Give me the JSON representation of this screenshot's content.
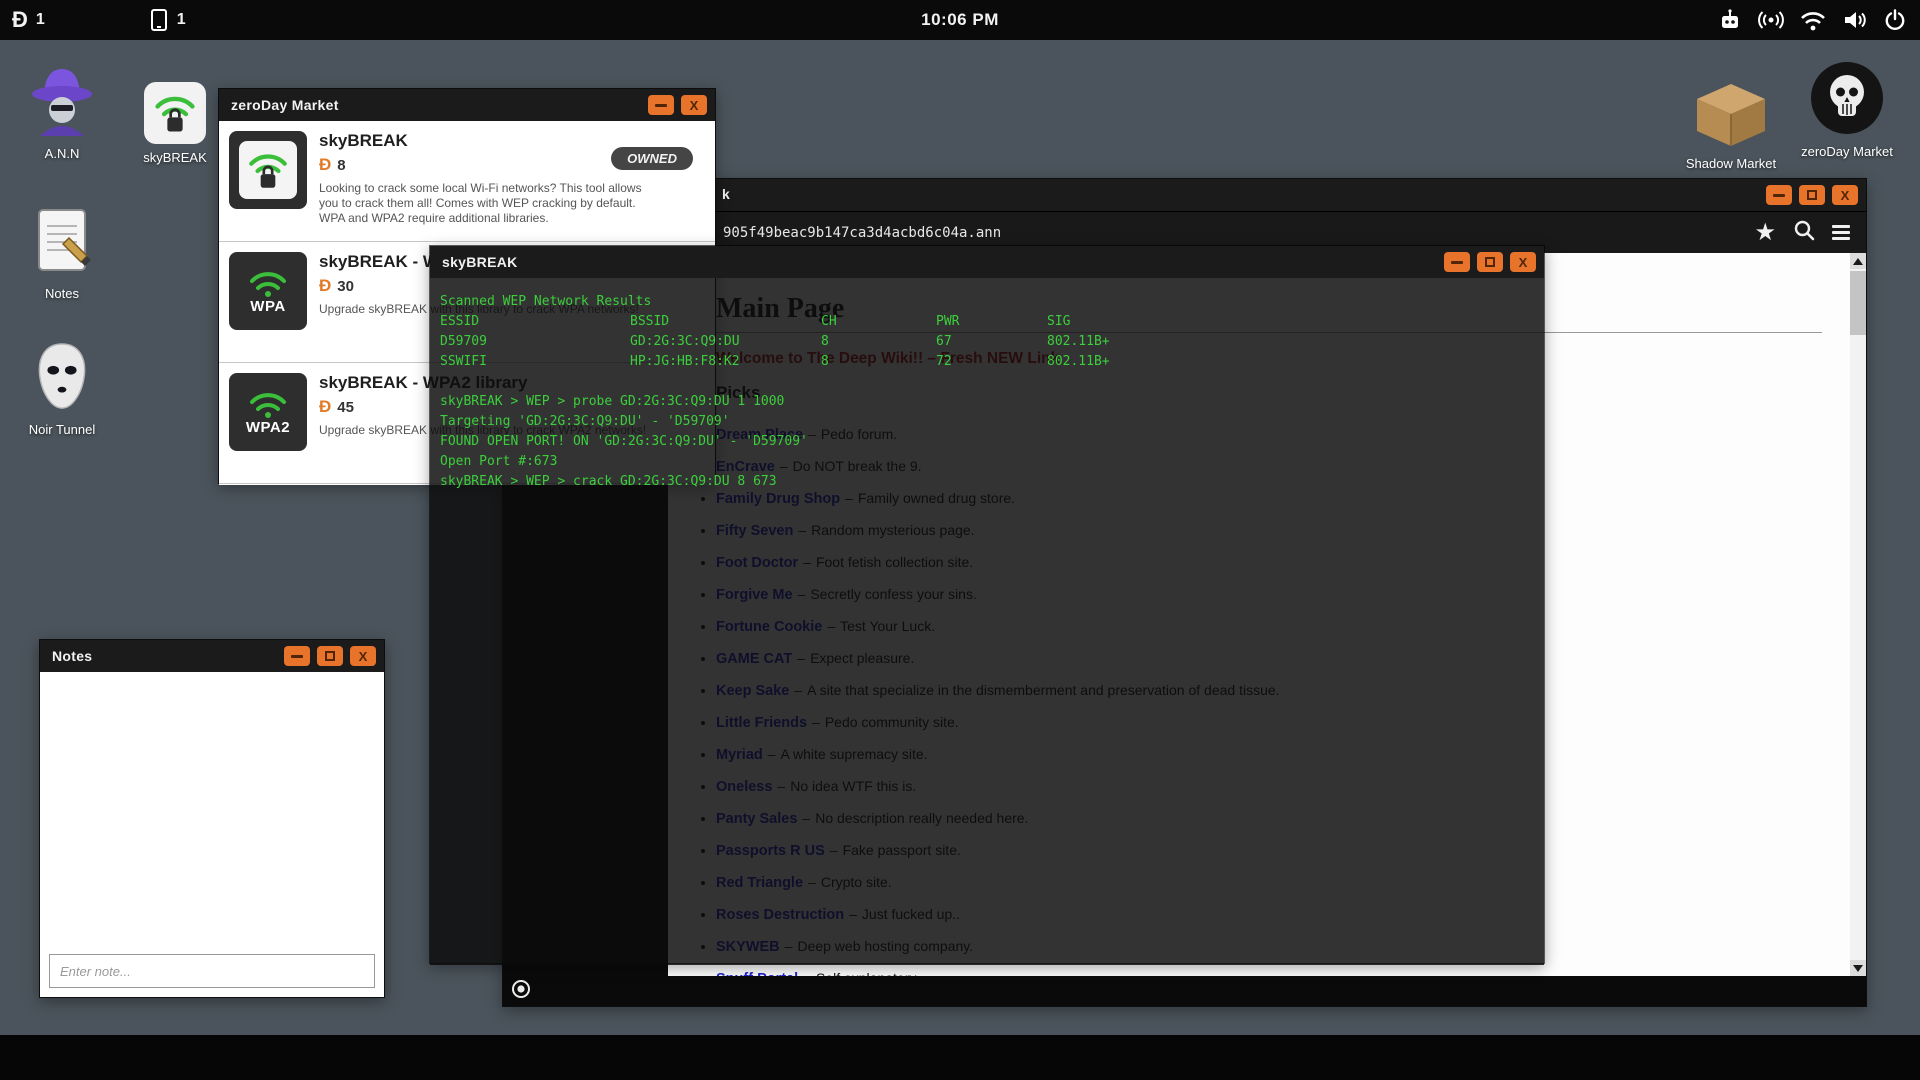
{
  "topbar": {
    "coin_symbol": "Đ",
    "coin_count": "1",
    "device_count": "1",
    "clock": "10:06 PM"
  },
  "icons": {
    "close_glyph": "X",
    "star_glyph": "★"
  },
  "desktop": {
    "icons": {
      "ann": {
        "label": "A.N.N"
      },
      "skybreak": {
        "label": "skyBREAK"
      },
      "notes": {
        "label": "Notes"
      },
      "noir": {
        "label": "Noir Tunnel"
      },
      "shadow": {
        "label": "Shadow Market"
      },
      "zeroday": {
        "label": "zeroDay Market"
      }
    }
  },
  "market_window": {
    "title": "zeroDay Market",
    "coin_symbol": "Đ",
    "items": [
      {
        "title": "skyBREAK",
        "price": "8",
        "badge": "OWNED",
        "lock": true,
        "tier": "",
        "desc": "Looking to crack some local Wi-Fi networks? This tool allows you to crack them all! Comes with WEP cracking by default. WPA and WPA2 require additional libraries."
      },
      {
        "title": "skyBREAK - WPA library",
        "price": "30",
        "tier": "WPA",
        "desc": "Upgrade skyBREAK with this library to crack WPA networks!"
      },
      {
        "title": "skyBREAK - WPA2 library",
        "price": "45",
        "tier": "WPA2",
        "desc": "Upgrade skyBREAK with this library to crack WPA2 networks!"
      }
    ]
  },
  "terminal_window": {
    "title": "skyBREAK",
    "scan_header": "Scanned WEP Network Results",
    "columns": [
      "ESSID",
      "BSSID",
      "CH",
      "PWR",
      "SIG"
    ],
    "networks": [
      {
        "essid": "D59709",
        "bssid": "GD:2G:3C:Q9:DU",
        "ch": "8",
        "pwr": "67",
        "sig": "802.11B+"
      },
      {
        "essid": "SSWIFI",
        "bssid": "HP:JG:HB:F8:K2",
        "ch": "8",
        "pwr": "72",
        "sig": "802.11B+"
      }
    ],
    "lines": [
      "skyBREAK > WEP > probe GD:2G:3C:Q9:DU 1 1000",
      "Targeting 'GD:2G:3C:Q9:DU' - 'D59709'",
      "FOUND OPEN PORT! ON 'GD:2G:3C:Q9:DU' - 'D59709'",
      "Open Port #:673",
      "skyBREAK > WEP > crack GD:2G:3C:Q9:DU 8 673"
    ]
  },
  "browser_window": {
    "title_fragment": "k",
    "url": "905f49beac9b147ca3d4acbd6c04a.ann",
    "page": {
      "heading": "Main Page",
      "welcome": "Welcome to The Deep Wiki!! – Fresh NEW Link",
      "section_title": "Picks",
      "separator": "–",
      "links": [
        {
          "name": "Dream Place",
          "desc": "Pedo forum."
        },
        {
          "name": "EnCrave",
          "desc": "Do NOT break the 9."
        },
        {
          "name": "Family Drug Shop",
          "desc": "Family owned drug store."
        },
        {
          "name": "Fifty Seven",
          "desc": "Random mysterious page."
        },
        {
          "name": "Foot Doctor",
          "desc": "Foot fetish collection site."
        },
        {
          "name": "Forgive Me",
          "desc": "Secretly confess your sins."
        },
        {
          "name": "Fortune Cookie",
          "desc": "Test Your Luck."
        },
        {
          "name": "GAME CAT",
          "desc": "Expect pleasure."
        },
        {
          "name": "Keep Sake",
          "desc": "A site that specialize in the dismemberment and preservation of dead tissue."
        },
        {
          "name": "Little Friends",
          "desc": "Pedo community site."
        },
        {
          "name": "Myriad",
          "desc": "A white supremacy site."
        },
        {
          "name": "Oneless",
          "desc": "No idea WTF this is."
        },
        {
          "name": "Panty Sales",
          "desc": "No description really needed here."
        },
        {
          "name": "Passports R US",
          "desc": "Fake passport site."
        },
        {
          "name": "Red Triangle",
          "desc": "Crypto site."
        },
        {
          "name": "Roses Destruction",
          "desc": "Just fucked up.."
        },
        {
          "name": "SKYWEB",
          "desc": "Deep web hosting company."
        },
        {
          "name": "Snuff Portal",
          "desc": "Self explanatory."
        }
      ]
    }
  },
  "notes_window": {
    "title": "Notes",
    "input_placeholder": "Enter note..."
  },
  "colors": {
    "accent_orange": "#e8732a",
    "terminal_green": "#3ccf3c",
    "link_blue": "#2323cd",
    "alert_red": "#b31515",
    "desktop_bg": "#4b545c"
  }
}
